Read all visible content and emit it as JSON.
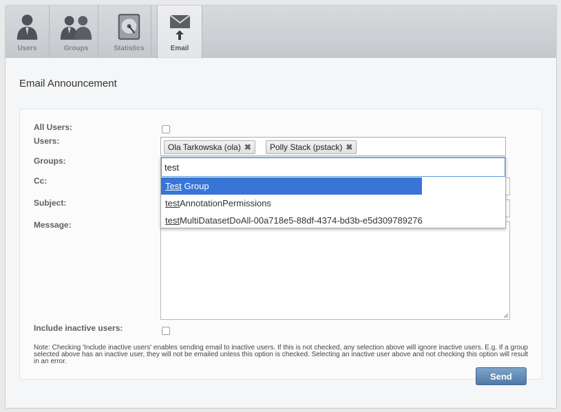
{
  "tabs": [
    {
      "label": "Users",
      "icon": "user-icon"
    },
    {
      "label": "Groups",
      "icon": "group-icon"
    },
    {
      "label": "Statistics",
      "icon": "hard-drive-icon"
    },
    {
      "label": "Email",
      "icon": "email-icon",
      "active": true
    }
  ],
  "page_title": "Email Announcement",
  "form": {
    "all_users_label": "All Users:",
    "users_label": "Users:",
    "groups_label": "Groups:",
    "cc_label": "Cc:",
    "subject_label": "Subject:",
    "message_label": "Message:",
    "include_inactive_label": "Include inactive users:",
    "selected_users": [
      {
        "name": "Ola Tarkowska (ola)"
      },
      {
        "name": "Polly Stack (pstack)"
      }
    ],
    "token_remove_glyph": "✖"
  },
  "dropdown": {
    "search_value": "test",
    "items": [
      {
        "match": "Test",
        "rest": " Group",
        "selected": true
      },
      {
        "match": "test",
        "rest": "AnnotationPermissions",
        "selected": false
      },
      {
        "match": "test",
        "rest": "MultiDatasetDoAll-00a718e5-88df-4374-bd3b-e5d309789276",
        "selected": false
      }
    ]
  },
  "note": "Note: Checking 'Include inactive users' enables sending email to inactive users. If this is not checked, any selection above will ignore inactive users. E.g. If a group selected above has an inactive user, they will not be emailed unless this option is checked. Selecting an inactive user above and not checking this option will result in an error.",
  "send_label": "Send",
  "colors": {
    "accent": "#3875d7",
    "send_button": "#5f87b0"
  }
}
